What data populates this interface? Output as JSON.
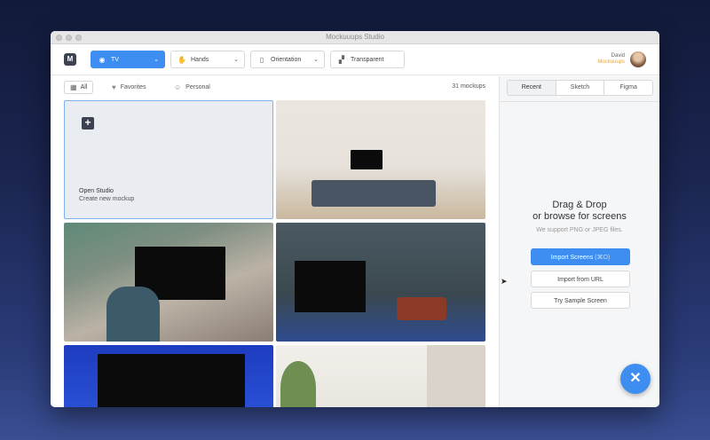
{
  "window": {
    "title": "Mockuuups Studio"
  },
  "brand": {
    "logo_letter": "M",
    "accent": "#3d8ef0"
  },
  "toolbar": {
    "device": {
      "label": "TV",
      "icon": "tv-icon"
    },
    "hands": {
      "label": "Hands",
      "icon": "hand-icon"
    },
    "orientation": {
      "label": "Orientation",
      "icon": "phone-portrait-icon"
    },
    "background": {
      "label": "Transparent",
      "icon": "transparent-checker-icon"
    }
  },
  "user": {
    "name": "David",
    "company": "Mockuuups"
  },
  "filters": {
    "all": "All",
    "favorites": "Favorites",
    "personal": "Personal",
    "count": "31 mockups"
  },
  "new_card": {
    "title": "Open Studio",
    "subtitle": "Create new mockup"
  },
  "sidebar": {
    "tabs": [
      "Recent",
      "Sketch",
      "Figma"
    ],
    "active_tab": "Recent",
    "drop_line1": "Drag & Drop",
    "drop_line2": "or browse for screens",
    "note": "We support PNG or JPEG files.",
    "import_label": "Import Screens",
    "import_hint": "(⌘O)",
    "url_label": "Import from URL",
    "sample_label": "Try Sample Screen"
  },
  "fab": {
    "icon": "close-icon",
    "glyph": "✕"
  }
}
